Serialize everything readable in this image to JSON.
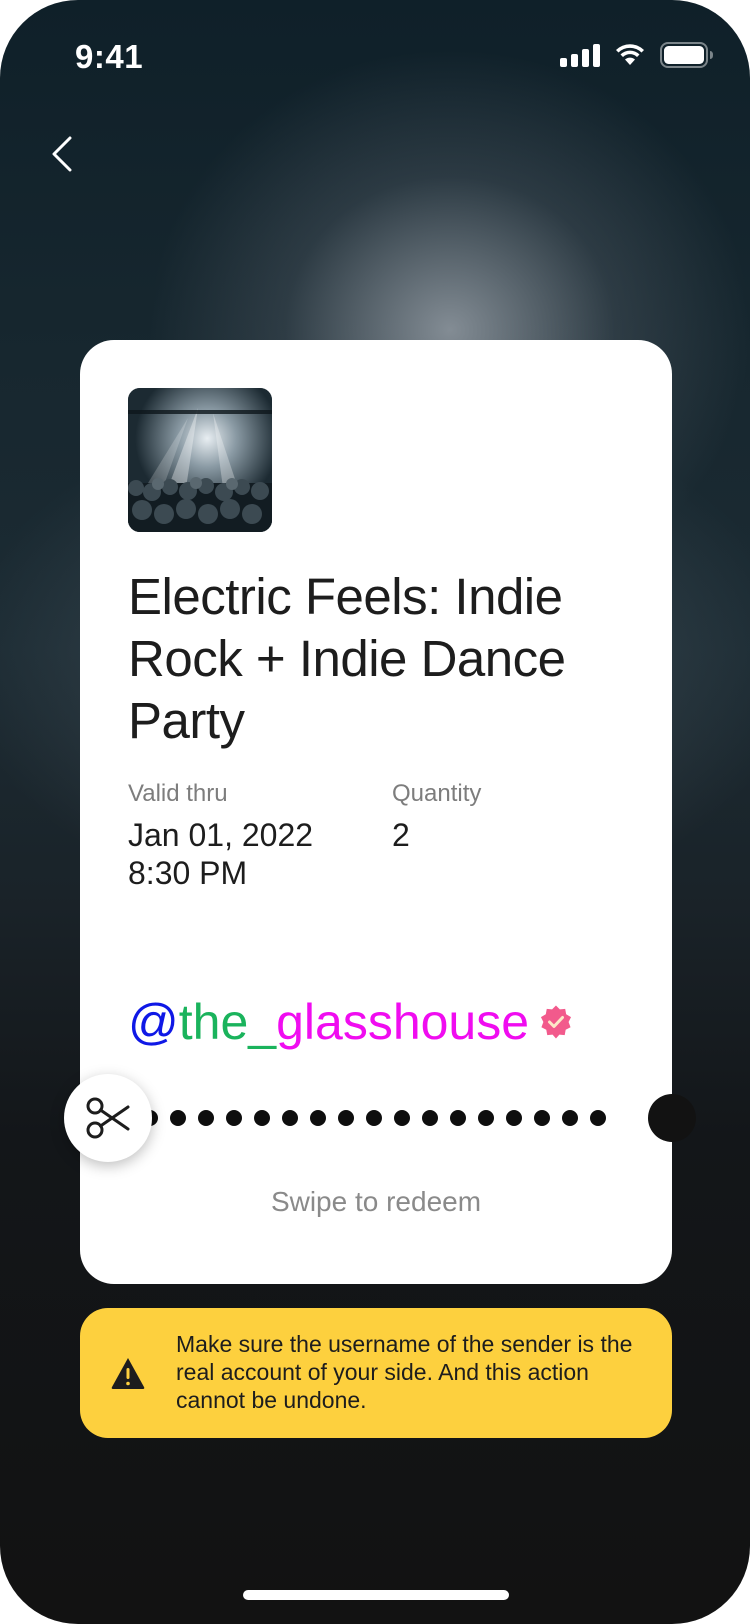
{
  "status_bar": {
    "time": "9:41",
    "icons": [
      "cellular-signal-icon",
      "wifi-icon",
      "battery-icon"
    ]
  },
  "nav": {
    "back_icon": "chevron-left-icon"
  },
  "ticket": {
    "thumbnail": "concert-crowd-image",
    "title": "Electric Feels: Indie Rock + Indie Dance Party",
    "valid_thru_label": "Valid thru",
    "valid_thru_date": "Jan 01, 2022",
    "valid_thru_time": "8:30 PM",
    "quantity_label": "Quantity",
    "quantity_value": "2",
    "username": {
      "at": "@",
      "the": "the_",
      "rest": "glasshouse",
      "verified_icon": "verified-badge-icon"
    },
    "scissors_icon": "scissors-icon",
    "swipe_text": "Swipe to redeem"
  },
  "warning": {
    "icon": "warning-triangle-icon",
    "text": "Make sure the username of the sender is the real account of your side. And this action cannot be undone."
  },
  "colors": {
    "warning_bg": "#fdd03e",
    "username_at": "#0f18e6",
    "username_the": "#1ab35c",
    "username_rest": "#f00cf0",
    "verified_badge": "#f25a8c"
  }
}
